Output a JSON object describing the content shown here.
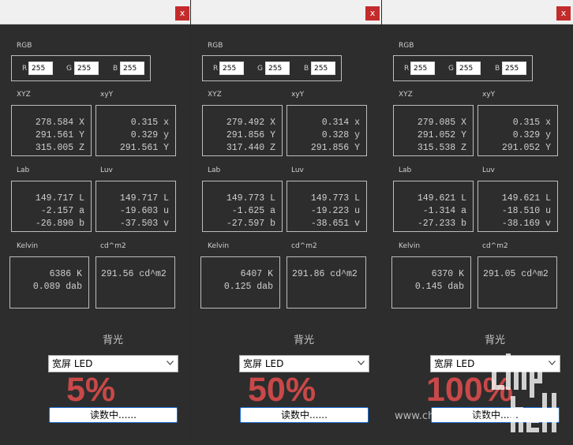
{
  "window": {
    "close_label": "x"
  },
  "labels": {
    "rgb": "RGB",
    "r": "R",
    "g": "G",
    "b": "B",
    "xyz": "XYZ",
    "xyY": "xyY",
    "lab": "Lab",
    "luv": "Luv",
    "kelvin": "Kelvin",
    "cdm2": "cd^m2",
    "backlight": "背光"
  },
  "panels": [
    {
      "rgb": {
        "r": "255",
        "g": "255",
        "b": "255"
      },
      "xyz": [
        "278.584 X",
        "291.561 Y",
        "315.005 Z"
      ],
      "xyY": [
        "0.315 x",
        "0.329 y",
        "291.561 Y"
      ],
      "lab": [
        "149.717 L",
        "-2.157 a",
        "-26.890 b"
      ],
      "luv": [
        "149.717 L",
        "-19.603 u",
        "-37.503 v"
      ],
      "kelvin": [
        "6386 K",
        "0.089 dab"
      ],
      "cdm2": "291.56 cd^m2",
      "dropdown": "宽屏 LED",
      "percent": "5%",
      "status": "读数中......"
    },
    {
      "rgb": {
        "r": "255",
        "g": "255",
        "b": "255"
      },
      "xyz": [
        "279.492 X",
        "291.856 Y",
        "317.440 Z"
      ],
      "xyY": [
        "0.314 x",
        "0.328 y",
        "291.856 Y"
      ],
      "lab": [
        "149.773 L",
        "-1.625 a",
        "-27.597 b"
      ],
      "luv": [
        "149.773 L",
        "-19.223 u",
        "-38.651 v"
      ],
      "kelvin": [
        "6407 K",
        "0.125 dab"
      ],
      "cdm2": "291.86 cd^m2",
      "dropdown": "宽屏 LED",
      "percent": "50%",
      "status": "读数中......"
    },
    {
      "rgb": {
        "r": "255",
        "g": "255",
        "b": "255"
      },
      "xyz": [
        "279.085 X",
        "291.052 Y",
        "315.538 Z"
      ],
      "xyY": [
        "0.315 x",
        "0.329 y",
        "291.052 Y"
      ],
      "lab": [
        "149.621 L",
        "-1.314 a",
        "-27.233 b"
      ],
      "luv": [
        "149.621 L",
        "-18.510 u",
        "-38.169 v"
      ],
      "kelvin": [
        "6370 K",
        "0.145 dab"
      ],
      "cdm2": "291.05 cd^m2",
      "dropdown": "宽屏 LED",
      "percent": "100%",
      "status": "读数中......"
    }
  ],
  "watermark": {
    "url": "www.chiphell.com",
    "logo_text": "chip hell"
  },
  "colors": {
    "percent": "#c94848",
    "close": "#c42b2b",
    "status_border": "#1e6fd6"
  }
}
